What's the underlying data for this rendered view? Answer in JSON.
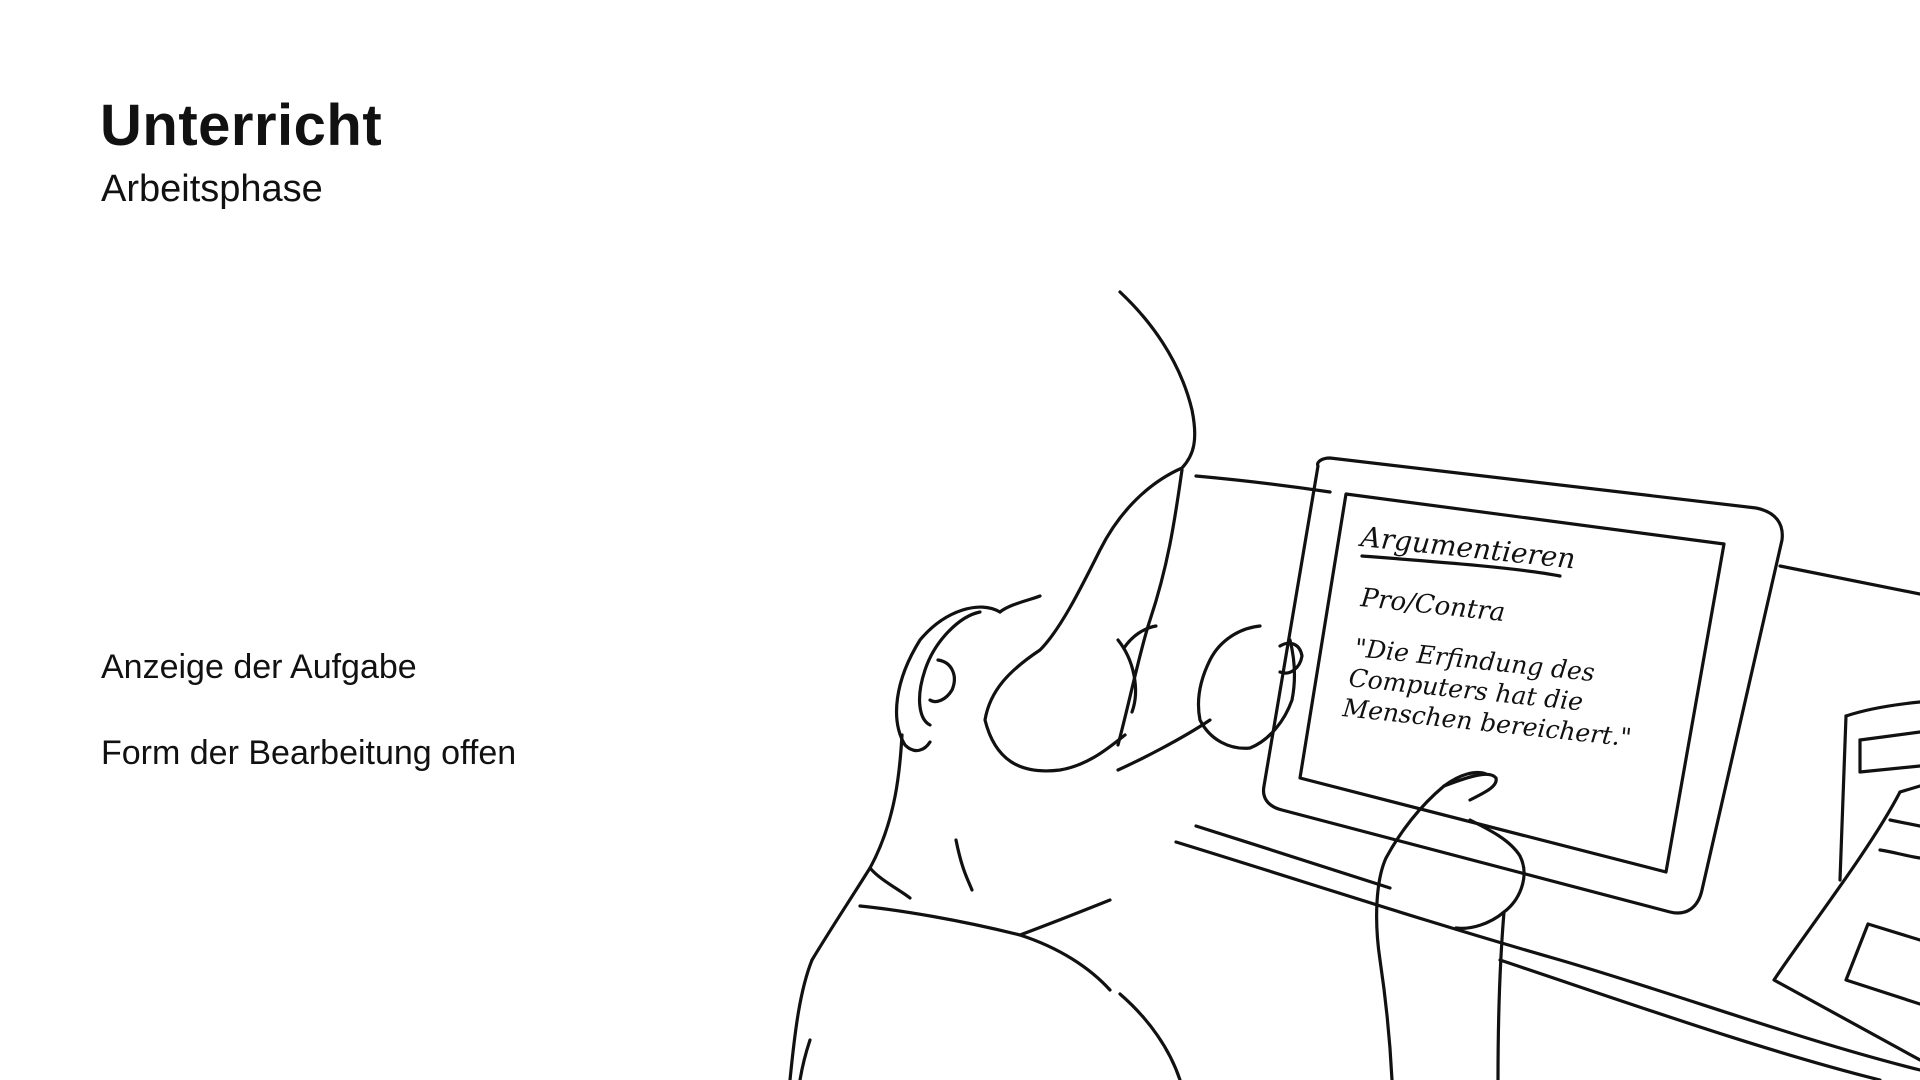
{
  "slide": {
    "title": "Unterricht",
    "subtitle": "Arbeitsphase"
  },
  "info": {
    "line1": "Anzeige der Aufgabe",
    "line2": "Form der Bearbeitung offen"
  },
  "illustration": {
    "screen": {
      "heading": "Argumentieren",
      "line1": "Pro/Contra",
      "quote1": "\"Die Erfindung des",
      "quote2": "Computers hat die",
      "quote3": "Menschen bereichert.\""
    }
  }
}
